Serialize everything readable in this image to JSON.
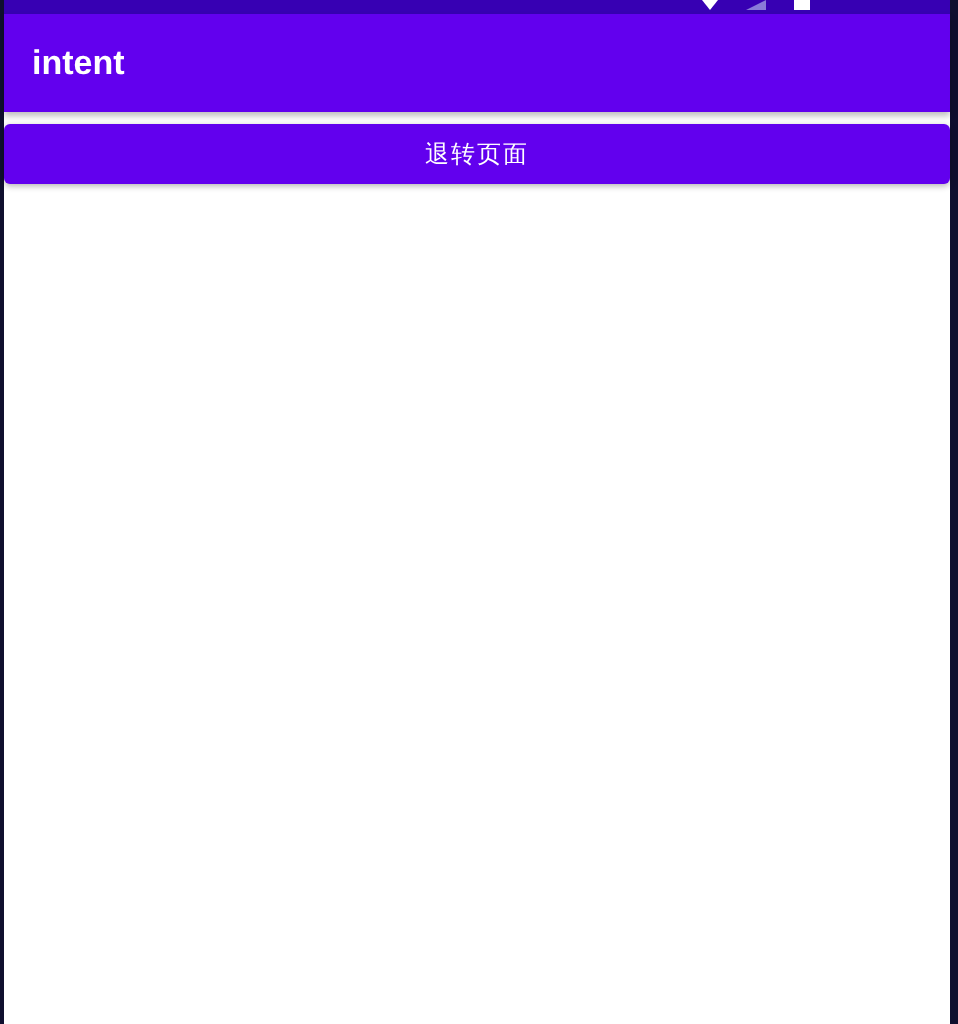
{
  "app_bar": {
    "title": "intent"
  },
  "button": {
    "label": "退转页面"
  }
}
